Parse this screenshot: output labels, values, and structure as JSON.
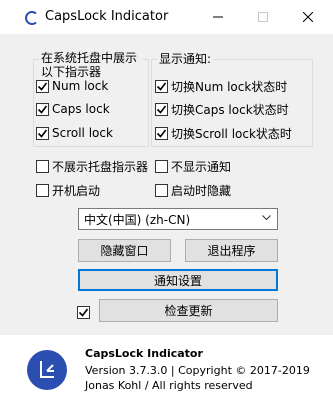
{
  "window": {
    "title": "CapsLock Indicator"
  },
  "tray_group": {
    "label": "在系统托盘中展示以下指示器",
    "items": [
      {
        "label": "Num lock",
        "checked": true
      },
      {
        "label": "Caps lock",
        "checked": true
      },
      {
        "label": "Scroll lock",
        "checked": true
      }
    ]
  },
  "notify_group": {
    "label": "显示通知:",
    "items": [
      {
        "label": "切换Num lock状态时",
        "checked": true
      },
      {
        "label": "切换Caps lock状态时",
        "checked": true
      },
      {
        "label": "切换Scroll lock状态时",
        "checked": true
      }
    ]
  },
  "options": {
    "hide_tray_indicator": {
      "label": "不展示托盘指示器",
      "checked": false
    },
    "no_notifications": {
      "label": "不显示通知",
      "checked": false
    },
    "start_at_boot": {
      "label": "开机启动",
      "checked": false
    },
    "hide_on_start": {
      "label": "启动时隐藏",
      "checked": false
    }
  },
  "language": {
    "selected": "中文(中国) (zh-CN)"
  },
  "buttons": {
    "hide_window": "隐藏窗口",
    "exit_program": "退出程序",
    "notification_settings": "通知设置",
    "check_updates": "检查更新"
  },
  "update_check": {
    "checked": true
  },
  "footer": {
    "app_name": "CapsLock Indicator",
    "version_line": "Version 3.7.3.0 | Copyright © 2017-2019",
    "author_line": "Jonas Kohl / All rights reserved"
  },
  "colors": {
    "accent": "#0078d7",
    "logo": "#2a4fb0"
  }
}
